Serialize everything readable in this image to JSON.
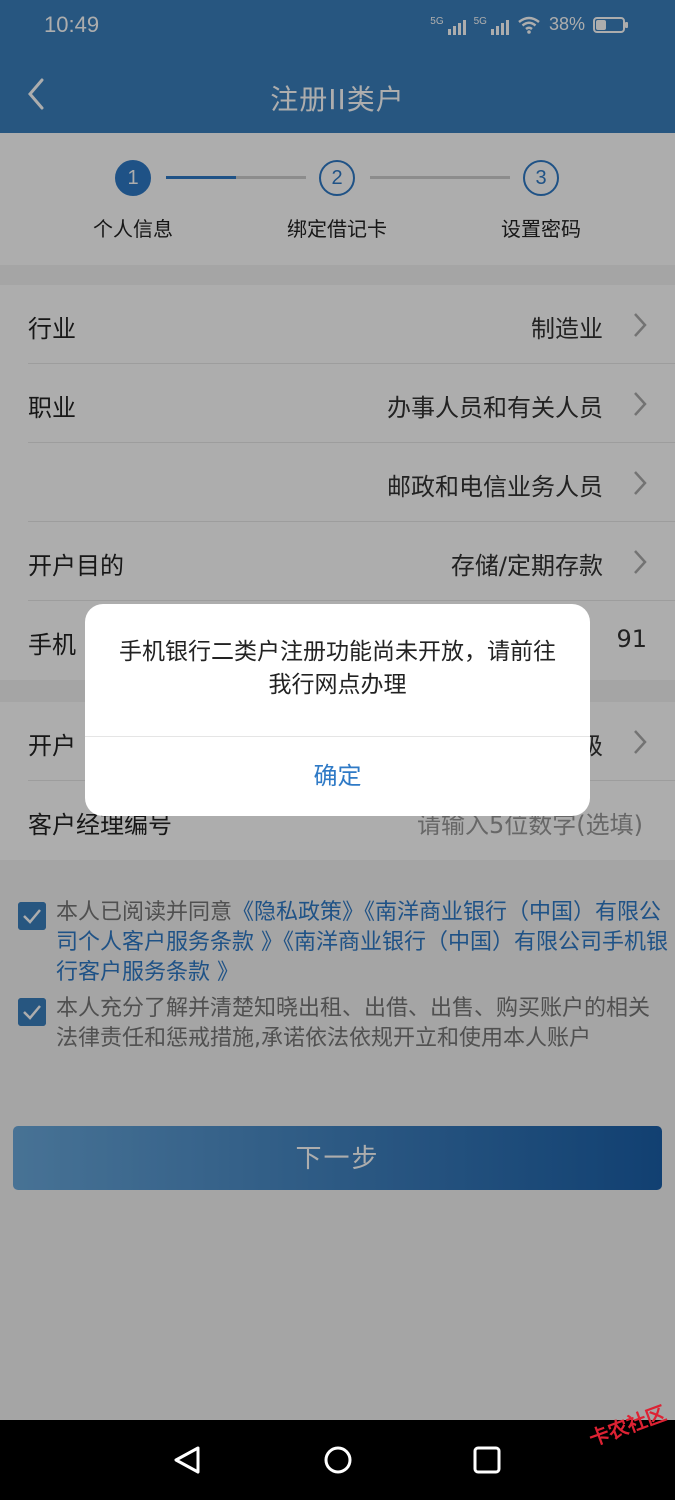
{
  "status": {
    "time": "10:49",
    "net1": "5G",
    "net2": "5G",
    "battery": "38%",
    "battery_level": 0.38
  },
  "header": {
    "title": "注册II类户"
  },
  "steps": [
    {
      "num": "1",
      "label": "个人信息"
    },
    {
      "num": "2",
      "label": "绑定借记卡"
    },
    {
      "num": "3",
      "label": "设置密码"
    }
  ],
  "form": {
    "industry_label": "行业",
    "industry_value": "制造业",
    "occupation_label": "职业",
    "occupation_value": "办事人员和有关人员",
    "occupation_sub_value": "邮政和电信业务人员",
    "purpose_label": "开户目的",
    "purpose_value": "存储/定期存款",
    "phone_label": "手机",
    "phone_value": "91",
    "branch_label": "开户",
    "branch_value": "级",
    "manager_label": "客户经理编号",
    "manager_placeholder": "请输入5位数字(选填)"
  },
  "agreements": {
    "a1_prefix": "本人已阅读并同意",
    "a1_link1": "《隐私政策》",
    "a1_link2": "《南洋商业银行（中国）有限公司个人客户服务条款 》",
    "a1_link3": "《南洋商业银行（中国）有限公司手机银行客户服务条款 》",
    "a2_text": "本人充分了解并清楚知晓出租、出借、出售、购买账户的相关法律责任和惩戒措施,承诺依法依规开立和使用本人账户"
  },
  "next_button": "下一步",
  "dialog": {
    "message": "手机银行二类户注册功能尚未开放，请前往我行网点办理",
    "ok": "确定"
  },
  "watermark": "卡农社区",
  "colors": {
    "brand": "#3a7fbd",
    "accent": "#2f7ac6"
  }
}
